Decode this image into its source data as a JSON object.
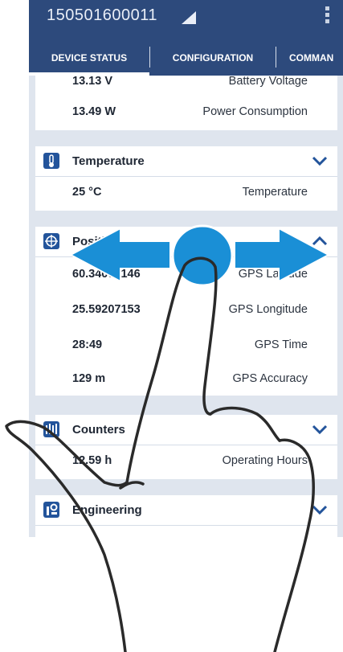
{
  "status_bar": {
    "device_id": "150501600011"
  },
  "tabs": [
    {
      "label": "DEVICE STATUS"
    },
    {
      "label": "CONFIGURATION"
    },
    {
      "label": "COMMAN"
    }
  ],
  "power_card": {
    "rows": [
      {
        "value": "13.13 V",
        "label": "Battery Voltage"
      },
      {
        "value": "13.49 W",
        "label": "Power Consumption"
      }
    ]
  },
  "temperature_card": {
    "title": "Temperature",
    "icon": "thermometer-icon",
    "rows": [
      {
        "value": "25 °C",
        "label": "Temperature"
      }
    ]
  },
  "position_card": {
    "title": "Position",
    "icon": "crosshair-icon",
    "rows": [
      {
        "value": "60.34006146",
        "label": "GPS Latitude"
      },
      {
        "value": "25.59207153",
        "label": "GPS Longitude"
      },
      {
        "value": "28:49",
        "label": "GPS Time"
      },
      {
        "value": "129 m",
        "label": "GPS Accuracy"
      }
    ]
  },
  "counters_card": {
    "title": "Counters",
    "icon": "counters-icon",
    "rows": [
      {
        "value": "12.59 h",
        "label": "Operating Hours"
      }
    ]
  },
  "engineering_card": {
    "title": "Engineering",
    "icon": "engineering-icon"
  },
  "overlay": {
    "gesture": "swipe-left-right-icon"
  },
  "colors": {
    "header": "#2d4a7c",
    "background": "#dfe5ee",
    "icon": "#23549b",
    "arrow": "#1a8fd6"
  }
}
